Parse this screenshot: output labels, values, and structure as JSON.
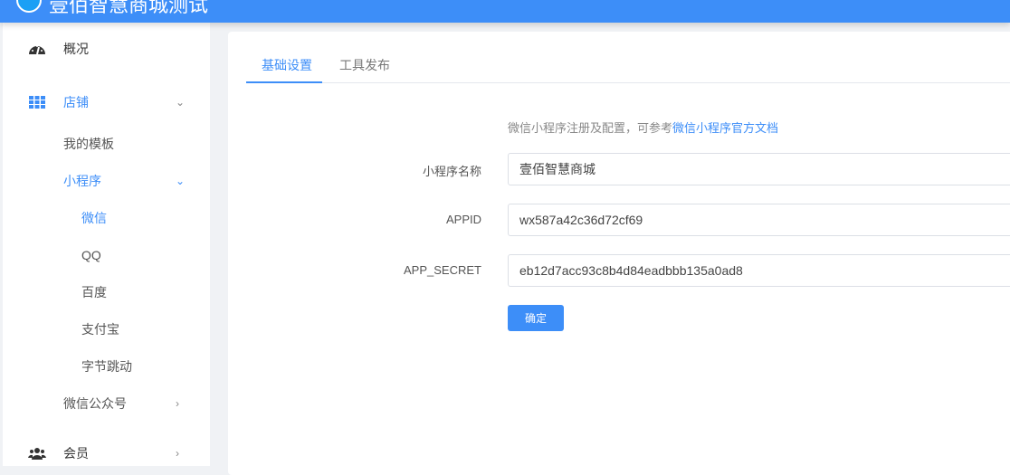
{
  "header": {
    "title": "壹佰智慧商城测试"
  },
  "sidebar": {
    "items": [
      {
        "label": "概况"
      },
      {
        "label": "店铺"
      },
      {
        "label": "我的模板"
      },
      {
        "label": "小程序"
      },
      {
        "label": "微信"
      },
      {
        "label": "QQ"
      },
      {
        "label": "百度"
      },
      {
        "label": "支付宝"
      },
      {
        "label": "字节跳动"
      },
      {
        "label": "微信公众号"
      },
      {
        "label": "会员"
      }
    ]
  },
  "tabs": [
    {
      "label": "基础设置"
    },
    {
      "label": "工具发布"
    }
  ],
  "form": {
    "hint": "微信小程序注册及配置，可参考",
    "hint_link": "微信小程序官方文档",
    "name_label": "小程序名称",
    "name_value": "壹佰智慧商城",
    "appid_label": "APPID",
    "appid_value": "wx587a42c36d72cf69",
    "secret_label": "APP_SECRET",
    "secret_value": "eb12d7acc93c8b4d84eadbbb135a0ad8",
    "submit": "确定"
  }
}
